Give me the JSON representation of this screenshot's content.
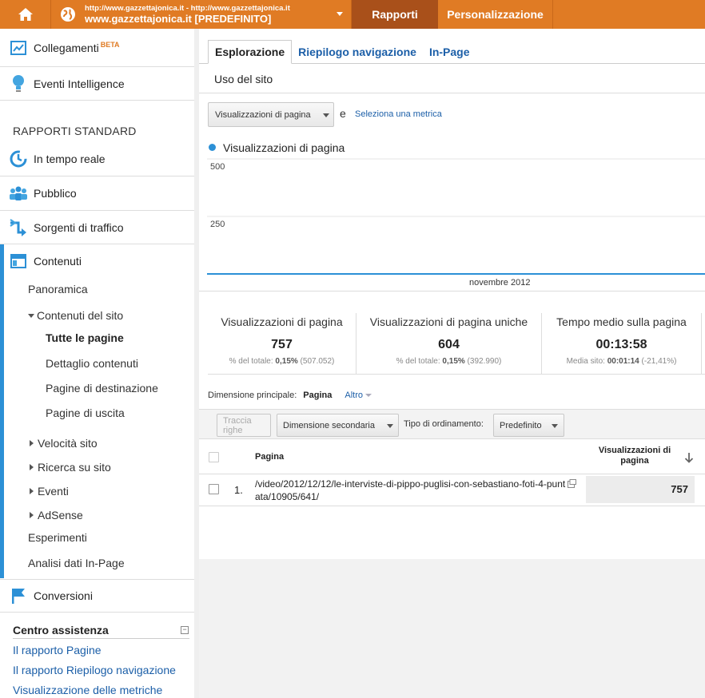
{
  "topbar": {
    "account_url": "http://www.gazzettajonica.it - http://www.gazzettajonica.it",
    "account_name": "www.gazzettajonica.it [PREDEFINITO]",
    "nav": [
      "Rapporti",
      "Personalizzazione"
    ]
  },
  "sidebar": {
    "collegamenti": "Collegamenti",
    "beta": "BETA",
    "eventi_intelligence": "Eventi Intelligence",
    "section_title": "RAPPORTI STANDARD",
    "items": [
      "In tempo reale",
      "Pubblico",
      "Sorgenti di traffico",
      "Contenuti"
    ],
    "contenuti_sub": {
      "panoramica": "Panoramica",
      "contenuti_sito": "Contenuti del sito",
      "tutte_pagine": "Tutte le pagine",
      "dettaglio": "Dettaglio contenuti",
      "destinazione": "Pagine di destinazione",
      "uscita": "Pagine di uscita",
      "velocita": "Velocità sito",
      "ricerca": "Ricerca su sito",
      "eventi": "Eventi",
      "adsense": "AdSense",
      "esperimenti": "Esperimenti",
      "analisi": "Analisi dati In-Page"
    },
    "conversioni": "Conversioni",
    "help": {
      "title": "Centro assistenza",
      "links": [
        "Il rapporto Pagine",
        "Il rapporto Riepilogo navigazione",
        "Visualizzazione delle metriche"
      ]
    }
  },
  "main": {
    "tabs": [
      "Esplorazione",
      "Riepilogo navigazione",
      "In-Page"
    ],
    "usage_label": "Uso del sito",
    "metric_select": "Visualizzazioni di pagina",
    "and_label": "e",
    "select_metric_link": "Seleziona una metrica",
    "legend": "Visualizzazioni di pagina",
    "scorecards": [
      {
        "title": "Visualizzazioni di pagina",
        "value": "757",
        "sub_prefix": "% del totale: ",
        "sub_bold": "0,15%",
        "sub_rest": " (507.052)"
      },
      {
        "title": "Visualizzazioni di pagina uniche",
        "value": "604",
        "sub_prefix": "% del totale: ",
        "sub_bold": "0,15%",
        "sub_rest": " (392.990)"
      },
      {
        "title": "Tempo medio sulla pagina",
        "value": "00:13:58",
        "sub_prefix": "Media sito: ",
        "sub_bold": "00:01:14",
        "sub_rest": " (-21,41%)"
      }
    ],
    "dimension": {
      "label": "Dimensione principale:",
      "active": "Pagina",
      "other": "Altro"
    },
    "toolbar": {
      "track_rows": "Traccia righe",
      "secondary_dim": "Dimensione secondaria",
      "sort_label": "Tipo di ordinamento:",
      "sort_value": "Predefinito"
    },
    "table": {
      "col_page": "Pagina",
      "col_views": "Visualizzazioni di pagina",
      "rows": [
        {
          "num": "1.",
          "page": "/video/2012/12/12/le-interviste-di-pippo-puglisi-con-sebastiano-foti-4-puntata/10905/641/",
          "views": "757"
        }
      ]
    }
  },
  "chart_data": {
    "type": "line",
    "title": "",
    "series": [
      {
        "name": "Visualizzazioni di pagina",
        "values": [
          0,
          0,
          0,
          0,
          0,
          0,
          0,
          0,
          0,
          0,
          0,
          0,
          0,
          0,
          0,
          0,
          0,
          0,
          0,
          0,
          0,
          0,
          0,
          0,
          0,
          0,
          0,
          0,
          0,
          0
        ]
      }
    ],
    "yticks": [
      "500",
      "250"
    ],
    "ylim": [
      0,
      500
    ],
    "xlabel": "novembre 2012",
    "color": "#2c90d6",
    "grid": true
  }
}
